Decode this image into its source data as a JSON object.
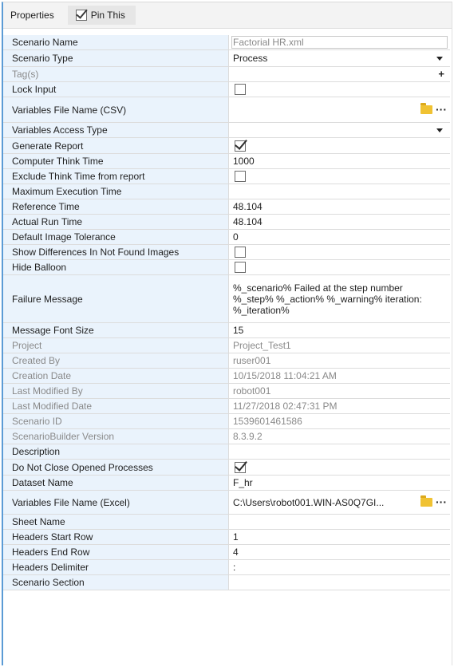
{
  "toolbar": {
    "title": "Properties",
    "pin_label": "Pin This",
    "pin_checked": true
  },
  "rows": {
    "scenario_name": {
      "name": "Scenario Name",
      "value": "Factorial HR.xml"
    },
    "scenario_type": {
      "name": "Scenario Type",
      "value": "Process"
    },
    "tags": {
      "name": "Tag(s)",
      "value": ""
    },
    "lock_input": {
      "name": "Lock Input",
      "checked": false
    },
    "variables_csv": {
      "name": "Variables File Name (CSV)",
      "value": ""
    },
    "variables_access": {
      "name": "Variables Access Type",
      "value": ""
    },
    "generate_report": {
      "name": "Generate Report",
      "checked": true
    },
    "think_time": {
      "name": "Computer Think Time",
      "value": "1000"
    },
    "exclude_think": {
      "name": "Exclude Think Time from report",
      "checked": false
    },
    "max_exec": {
      "name": "Maximum Execution Time",
      "value": ""
    },
    "reference_time": {
      "name": "Reference Time",
      "value": "48.104"
    },
    "actual_run_time": {
      "name": "Actual Run Time",
      "value": "48.104"
    },
    "image_tolerance": {
      "name": "Default Image Tolerance",
      "value": "0"
    },
    "show_diff": {
      "name": "Show Differences In Not Found Images",
      "checked": false
    },
    "hide_balloon": {
      "name": "Hide Balloon",
      "checked": false
    },
    "failure_message": {
      "name": "Failure Message",
      "value": "%_scenario% Failed at the step number %_step% %_action% %_warning% iteration: %_iteration%"
    },
    "message_font_size": {
      "name": "Message Font Size",
      "value": "15"
    },
    "project": {
      "name": "Project",
      "value": "Project_Test1"
    },
    "created_by": {
      "name": "Created By",
      "value": "ruser001"
    },
    "creation_date": {
      "name": "Creation Date",
      "value": "10/15/2018 11:04:21 AM"
    },
    "last_modified_by": {
      "name": "Last Modified By",
      "value": "robot001"
    },
    "last_modified_date": {
      "name": "Last Modified Date",
      "value": "11/27/2018 02:47:31 PM"
    },
    "scenario_id": {
      "name": "Scenario ID",
      "value": "1539601461586"
    },
    "builder_version": {
      "name": "ScenarioBuilder Version",
      "value": "8.3.9.2"
    },
    "description": {
      "name": "Description",
      "value": ""
    },
    "do_not_close": {
      "name": "Do Not Close Opened Processes",
      "checked": true
    },
    "dataset_name": {
      "name": "Dataset Name",
      "value": "F_hr"
    },
    "variables_excel": {
      "name": "Variables File Name (Excel)",
      "value": "C:\\Users\\robot001.WIN-AS0Q7GI..."
    },
    "sheet_name": {
      "name": "Sheet Name",
      "value": ""
    },
    "headers_start": {
      "name": "Headers Start Row",
      "value": "1"
    },
    "headers_end": {
      "name": "Headers End Row",
      "value": "4"
    },
    "headers_delimiter": {
      "name": "Headers Delimiter",
      "value": ":"
    },
    "scenario_section": {
      "name": "Scenario Section",
      "value": ""
    }
  },
  "icons": {
    "folder": "folder-icon",
    "ellipsis": "ellipsis-icon",
    "dropdown": "chevron-down-icon",
    "add": "plus-icon",
    "checkmark": "checkmark-icon"
  },
  "colors": {
    "name_column_bg": "#eaf3fc",
    "readonly_text": "#8a8a8a",
    "frame_accent": "#5b9bd5",
    "folder": "#f0c232"
  }
}
